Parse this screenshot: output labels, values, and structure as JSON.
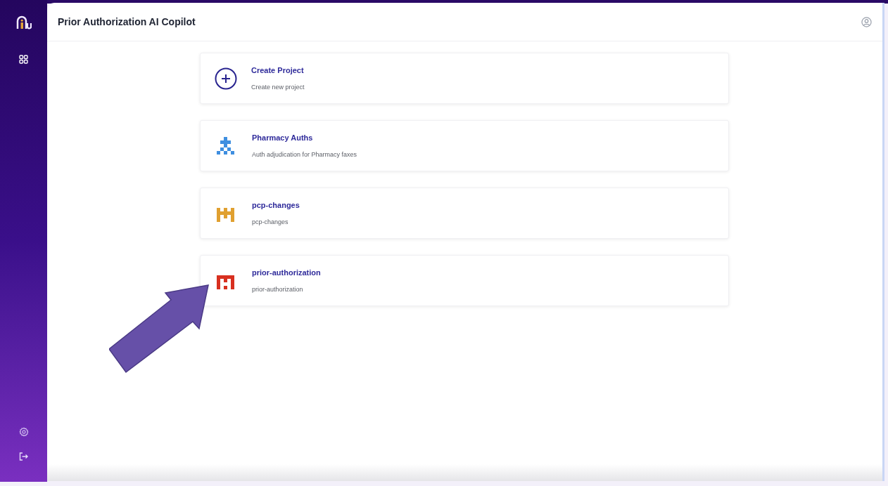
{
  "app": {
    "title": "Prior Authorization AI Copilot"
  },
  "projects": [
    {
      "kind": "create",
      "name": "Create Project",
      "description": "Create new project"
    },
    {
      "kind": "blue",
      "name": "Pharmacy Auths",
      "description": "Auth adjudication for Pharmacy faxes"
    },
    {
      "kind": "orange",
      "name": "pcp-changes",
      "description": "pcp-changes"
    },
    {
      "kind": "red",
      "name": "prior-authorization",
      "description": "prior-authorization"
    }
  ]
}
